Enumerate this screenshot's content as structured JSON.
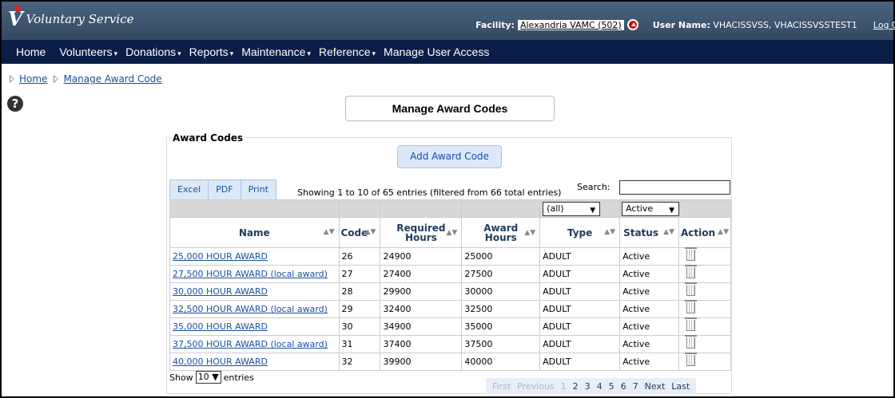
{
  "header": {
    "app_title": "Voluntary Service",
    "facility_label": "Facility:",
    "facility_value": "Alexandria VAMC (502)",
    "user_label": "User Name:",
    "user_value": "VHACISSVSS, VHACISSVSSTEST1",
    "logout": "Log Out"
  },
  "nav": {
    "items": [
      {
        "label": "Home",
        "dropdown": false
      },
      {
        "label": "Volunteers",
        "dropdown": true
      },
      {
        "label": "Donations",
        "dropdown": true
      },
      {
        "label": "Reports",
        "dropdown": true
      },
      {
        "label": "Maintenance",
        "dropdown": true
      },
      {
        "label": "Reference",
        "dropdown": true
      },
      {
        "label": "Manage User Access",
        "dropdown": false
      }
    ],
    "caret": "▾"
  },
  "breadcrumb": {
    "home": "Home",
    "current": "Manage Award Code"
  },
  "page_title": "Manage Award Codes",
  "panel": {
    "legend": "Award Codes",
    "add_button": "Add Award Code",
    "export": {
      "excel": "Excel",
      "pdf": "PDF",
      "print": "Print"
    },
    "info": "Showing 1 to 10 of 65 entries (filtered from 66 total entries)",
    "search_label": "Search:",
    "filters": {
      "type": "(all)",
      "status": "Active"
    },
    "columns": {
      "name": "Name",
      "code": "Code",
      "required_hours_1": "Required",
      "required_hours_2": "Hours",
      "award_hours_1": "Award",
      "award_hours_2": "Hours",
      "type": "Type",
      "status": "Status",
      "action": "Action"
    },
    "rows": [
      {
        "name": "25,000 HOUR AWARD",
        "code": "26",
        "required": "24900",
        "award": "25000",
        "type": "ADULT",
        "status": "Active"
      },
      {
        "name": "27,500 HOUR AWARD (local award)",
        "code": "27",
        "required": "27400",
        "award": "27500",
        "type": "ADULT",
        "status": "Active"
      },
      {
        "name": "30,000 HOUR AWARD",
        "code": "28",
        "required": "29900",
        "award": "30000",
        "type": "ADULT",
        "status": "Active"
      },
      {
        "name": "32,500 HOUR AWARD (local award)",
        "code": "29",
        "required": "32400",
        "award": "32500",
        "type": "ADULT",
        "status": "Active"
      },
      {
        "name": "35,000 HOUR AWARD",
        "code": "30",
        "required": "34900",
        "award": "35000",
        "type": "ADULT",
        "status": "Active"
      },
      {
        "name": "37,500 HOUR AWARD (local award)",
        "code": "31",
        "required": "37400",
        "award": "37500",
        "type": "ADULT",
        "status": "Active"
      },
      {
        "name": "40,000 HOUR AWARD",
        "code": "32",
        "required": "39900",
        "award": "40000",
        "type": "ADULT",
        "status": "Active"
      }
    ],
    "show_label": "Show",
    "show_value": "10",
    "entries_label": "entries",
    "pagination": {
      "first": "First",
      "previous": "Previous",
      "pages": [
        "1",
        "2",
        "3",
        "4",
        "5",
        "6",
        "7"
      ],
      "next": "Next",
      "last": "Last"
    }
  }
}
